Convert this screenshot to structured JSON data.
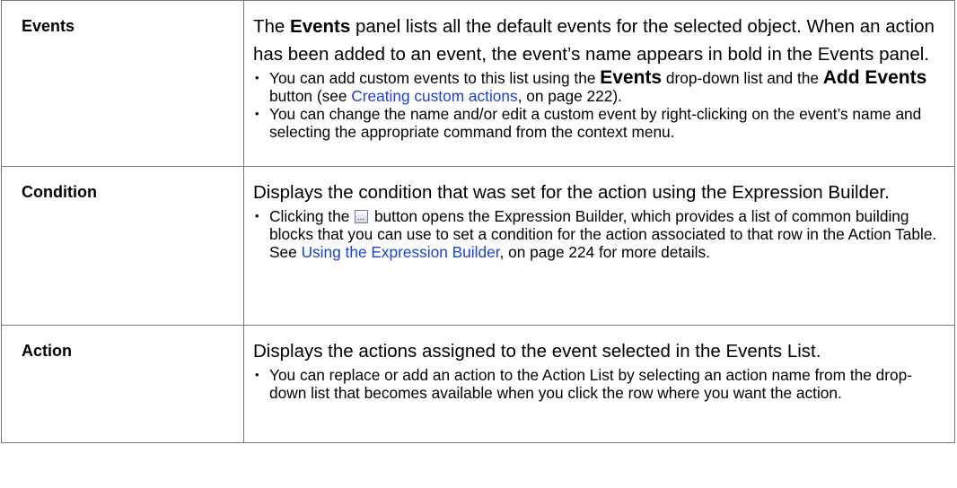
{
  "rows": [
    {
      "term": "Events",
      "para": [
        "The ",
        "Events",
        " panel lists all the default events for the selected object. When an action has been added to an event, the event’s name appears in bold in the Events panel."
      ],
      "bullets": [
        [
          "You can add custom events to this list using the ",
          "Events",
          " drop-down list and the ",
          "Add Events",
          " button (see ",
          "Creating custom actions",
          ", on page 222)."
        ],
        [
          "You can change the name and/or edit a custom event by right-clicking on the event’s name and selecting the appropriate command from the context menu."
        ]
      ]
    },
    {
      "term": "Condition",
      "para": "Displays the condition that was set for the action using the Expression Builder.",
      "bullets": [
        [
          "Clicking the ",
          " button opens the Expression Builder, which provides a list of common building blocks that you can use to set a condition for the action associated to that row in the Action Table. See ",
          "Using the Expression Builder",
          ", on page 224 for more details."
        ]
      ]
    },
    {
      "term": "Action",
      "para": "Displays the actions assigned to the event selected in the Events List.",
      "bullets": [
        [
          "You can replace or add an action to the Action List by selecting an action name from the drop-down list that becomes available when you click the row where you want the action."
        ]
      ]
    }
  ],
  "icons": {
    "ellipsis_button": "ellipsis-button-icon"
  }
}
